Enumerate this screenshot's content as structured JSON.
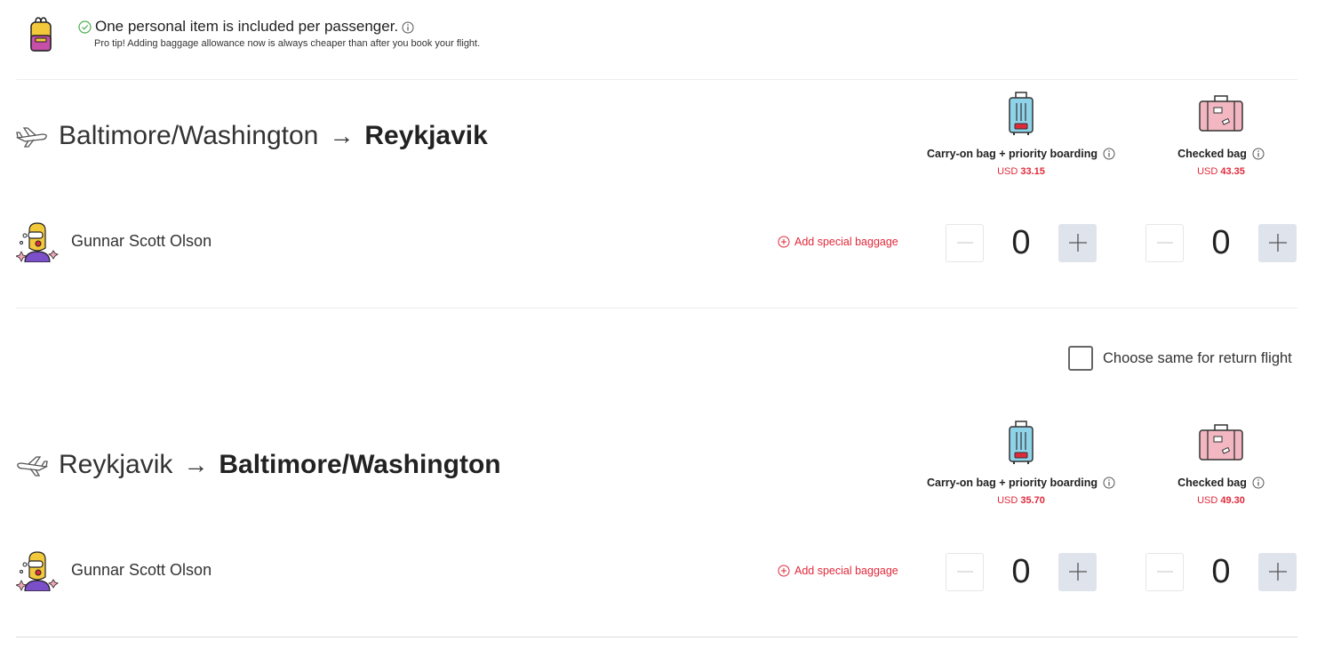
{
  "personal_item": {
    "message": "One personal item is included per passenger.",
    "tip": "Pro tip! Adding baggage allowance now is always cheaper than after you book your flight."
  },
  "flights": [
    {
      "from": "Baltimore/Washington",
      "arrow": "→",
      "to": "Reykjavik",
      "carry_on": {
        "label": "Carry-on bag + priority boarding",
        "currency": "USD",
        "price": "33.15"
      },
      "checked": {
        "label": "Checked bag",
        "currency": "USD",
        "price": "43.35"
      },
      "passenger": {
        "name": "Gunnar Scott Olson",
        "special_baggage": "Add special baggage",
        "carry_on_count": "0",
        "checked_count": "0"
      }
    },
    {
      "from": "Reykjavik",
      "arrow": "→",
      "to": "Baltimore/Washington",
      "carry_on": {
        "label": "Carry-on bag + priority boarding",
        "currency": "USD",
        "price": "35.70"
      },
      "checked": {
        "label": "Checked bag",
        "currency": "USD",
        "price": "49.30"
      },
      "passenger": {
        "name": "Gunnar Scott Olson",
        "special_baggage": "Add special baggage",
        "carry_on_count": "0",
        "checked_count": "0"
      }
    }
  ],
  "return_option": {
    "label": "Choose same for return flight",
    "checked": false
  },
  "colors": {
    "price_red": "#e0293a",
    "plus_button": "#dfe3ec",
    "check_green": "#4caf50"
  },
  "icons": [
    "backpack-icon",
    "check-circle-icon",
    "info-icon",
    "plane-departure-icon",
    "plane-return-icon",
    "carry-on-bag-icon",
    "checked-bag-icon",
    "avatar",
    "plus-circle-icon",
    "minus-icon",
    "plus-icon"
  ]
}
